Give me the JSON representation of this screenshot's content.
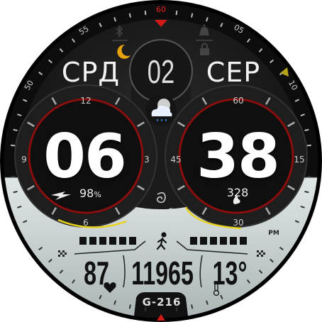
{
  "bezel": {
    "labels": [
      "60",
      "05",
      "10",
      "55",
      "50"
    ]
  },
  "date": {
    "weekday": "СРД",
    "day": "02",
    "month": "СЕР"
  },
  "time": {
    "hours": "06",
    "minutes": "38",
    "period": "PM"
  },
  "hour_dial": {
    "labels": [
      "12",
      "3",
      "6",
      "9"
    ]
  },
  "minute_dial": {
    "labels": [
      "60",
      "15",
      "30",
      "45"
    ]
  },
  "battery": {
    "value": "98",
    "unit": "%",
    "percent": 98
  },
  "calories": {
    "value": "328"
  },
  "brand": {
    "name": "amazfit"
  },
  "heart_rate": {
    "value": "87"
  },
  "steps": {
    "value": "11965"
  },
  "temperature": {
    "value": "13°"
  },
  "model": {
    "label": "G-216"
  },
  "status_icons": [
    "bluetooth-icon",
    "moon-icon",
    "bell-icon",
    "lock-icon"
  ],
  "weather": {
    "icon": "cloud-rain-night-icon"
  },
  "colors": {
    "accent_red": "#e0201c",
    "yellow": "#e8d21c",
    "moon": "#e8a20c",
    "lcd": "#c4cece"
  }
}
